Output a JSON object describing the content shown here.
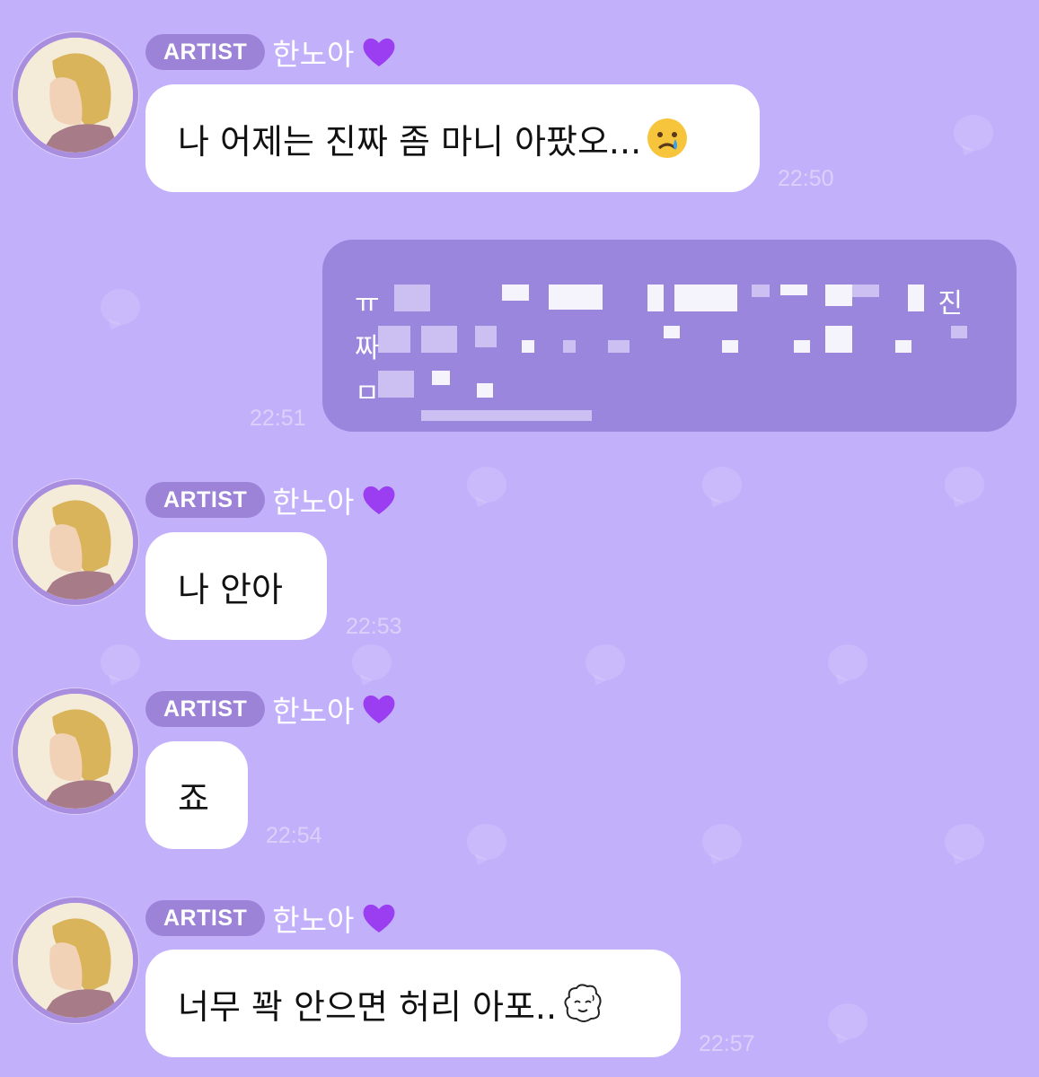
{
  "colors": {
    "background": "#c3b0fb",
    "badge": "#9c83d8",
    "my_bubble": "#9a86dc",
    "avatar_ring": "#a98dde",
    "heart": "#9b3df0"
  },
  "messages": [
    {
      "badge": "ARTIST",
      "name": "한노아",
      "text": "나 어제는 진짜 좀 마니 아팠오...",
      "emoji": "crying-face-icon",
      "time": "22:50"
    },
    {
      "badge": "ARTIST",
      "name": "한노아",
      "text": "나 안아",
      "time": "22:53"
    },
    {
      "badge": "ARTIST",
      "name": "한노아",
      "text": "죠",
      "time": "22:54"
    },
    {
      "badge": "ARTIST",
      "name": "한노아",
      "text": "너무 꽉 안으면 허리 아포..",
      "emoji": "sheep-sticker-icon",
      "time": "22:57"
    }
  ],
  "my_message": {
    "line1_start": "ㅠ",
    "line1_end": "진",
    "line2_start": "짜",
    "line3_start": "ㅁ",
    "time": "22:51",
    "redacted": true
  }
}
